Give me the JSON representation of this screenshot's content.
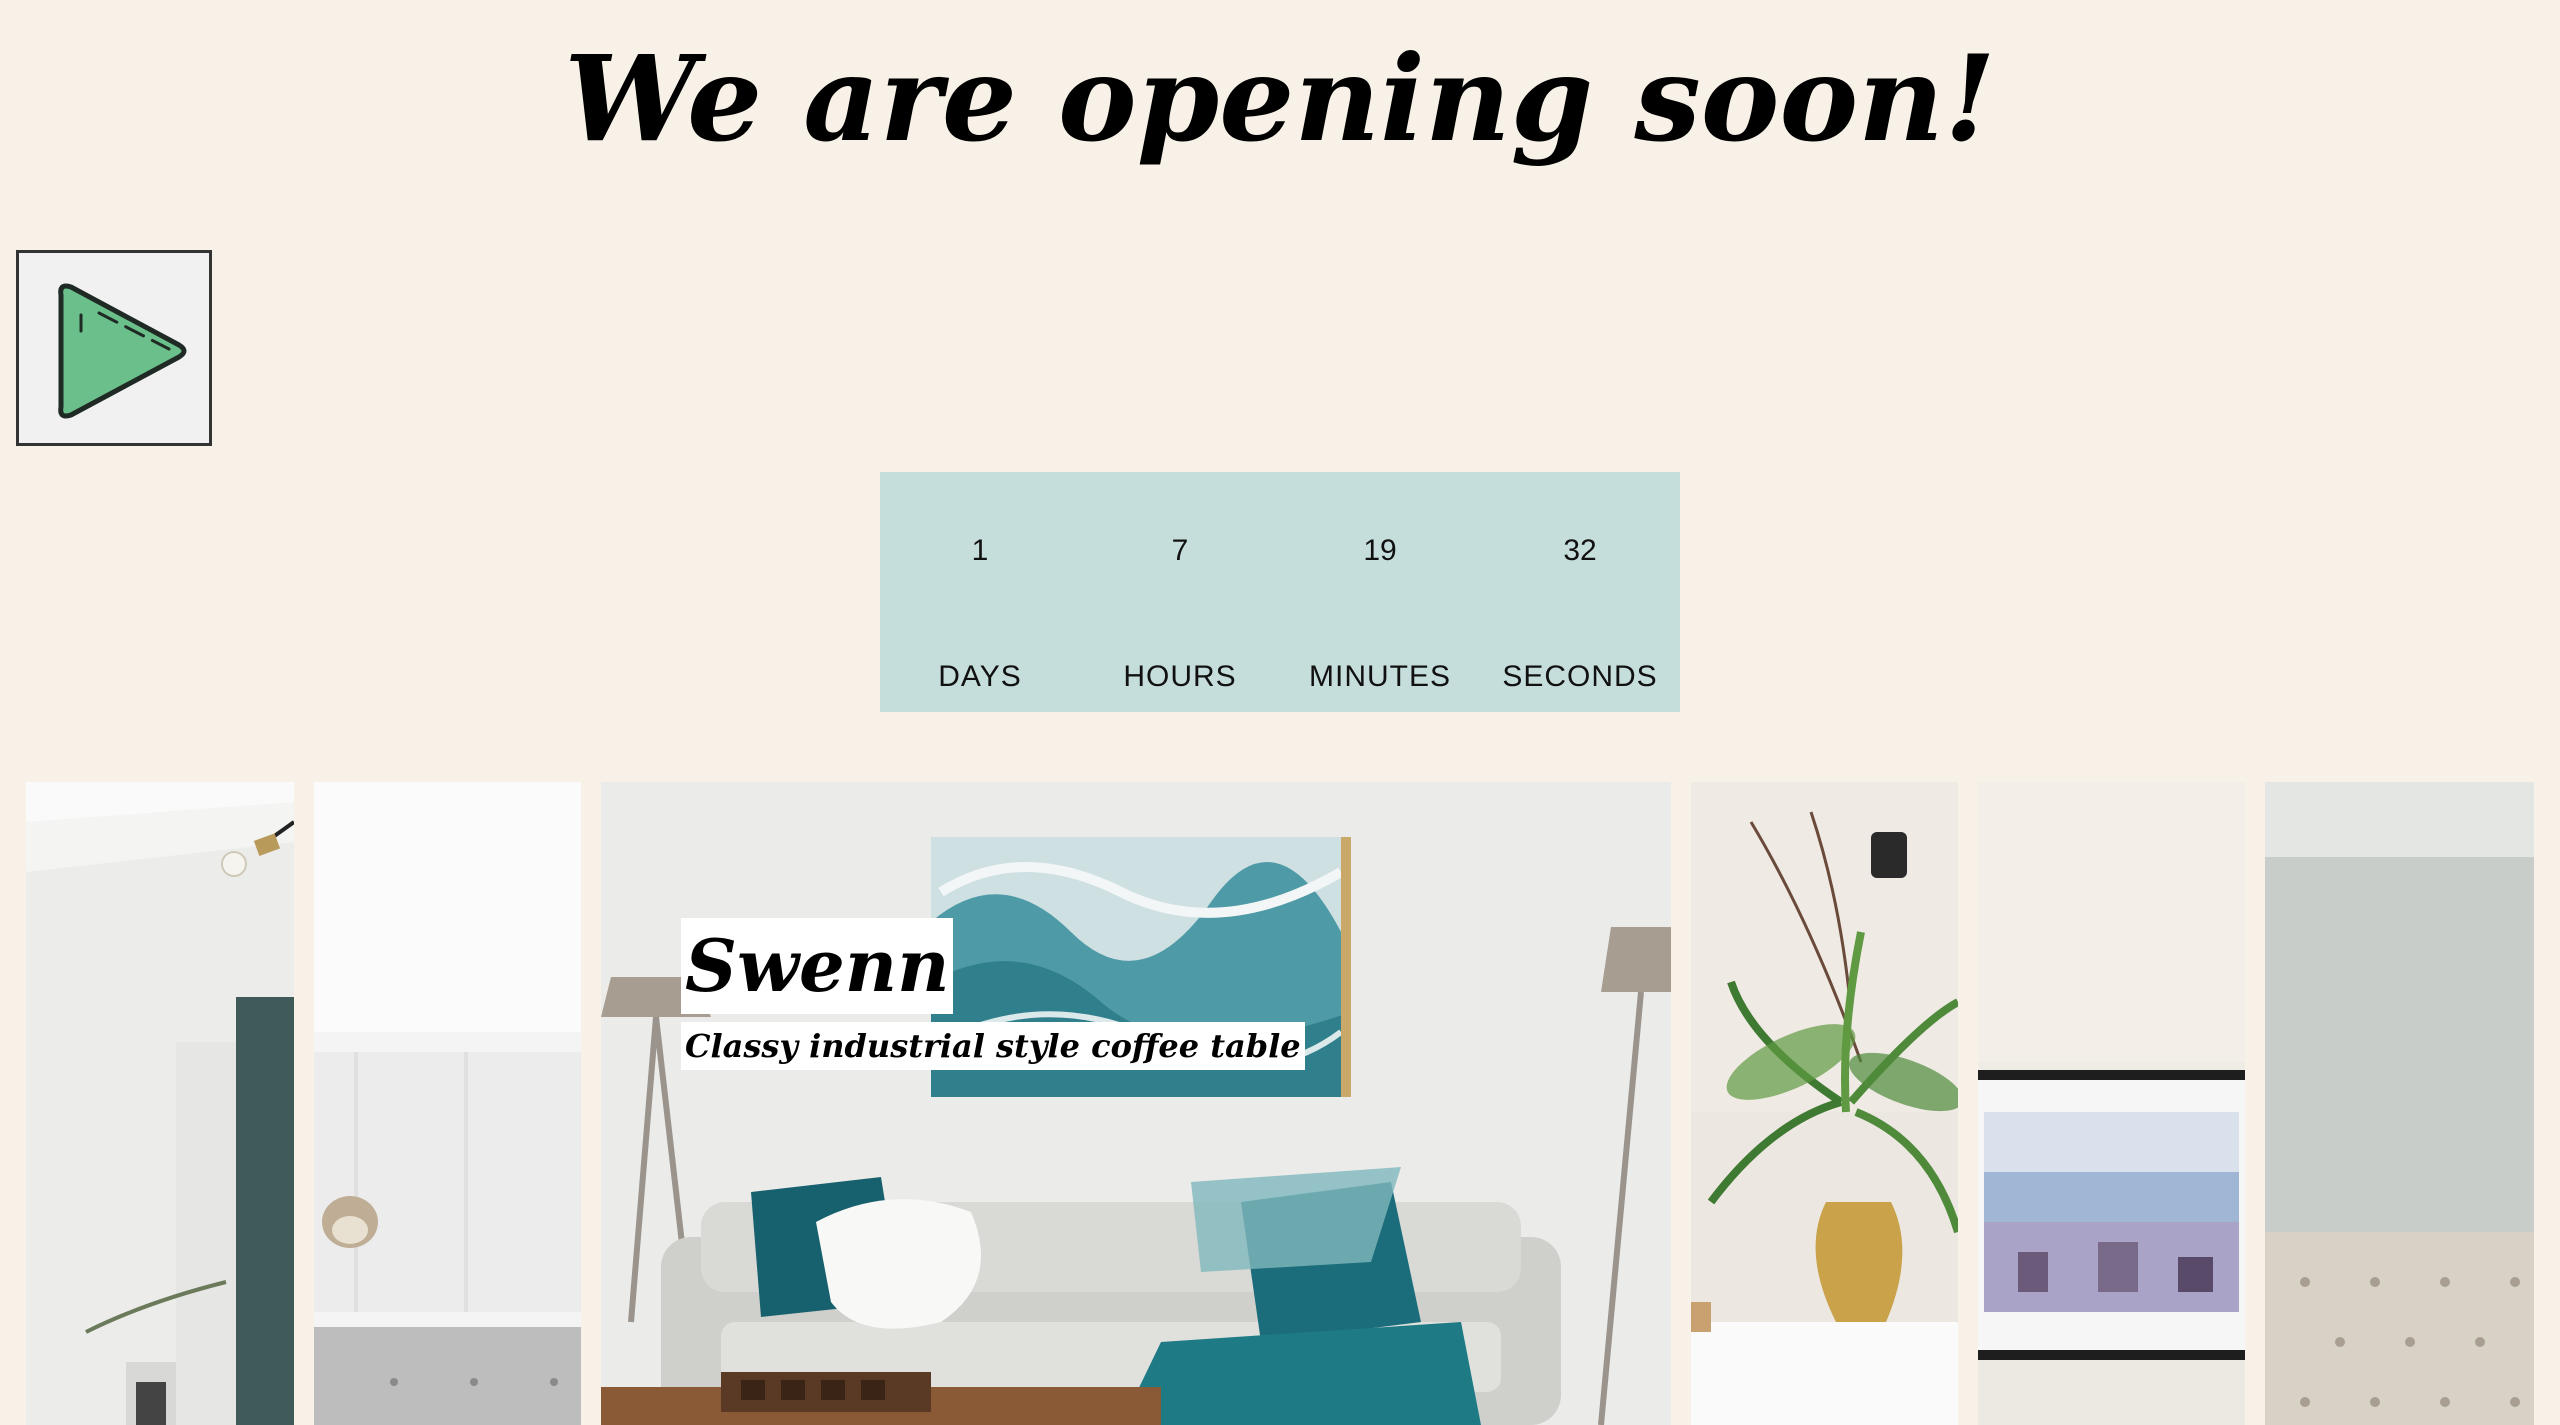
{
  "page": {
    "title": "We are opening soon!"
  },
  "play_button": {
    "icon": "play-icon"
  },
  "countdown": {
    "units": [
      {
        "value": "1",
        "label": "DAYS"
      },
      {
        "value": "7",
        "label": "HOURS"
      },
      {
        "value": "19",
        "label": "MINUTES"
      },
      {
        "value": "32",
        "label": "SECONDS"
      }
    ]
  },
  "gallery": {
    "active_caption": {
      "title": "Swenn",
      "subtitle": "Classy industrial style coffee table"
    }
  },
  "colors": {
    "background": "#f8f1e8",
    "countdown_bg": "#c6dedb",
    "play_green": "#6abf8a"
  }
}
